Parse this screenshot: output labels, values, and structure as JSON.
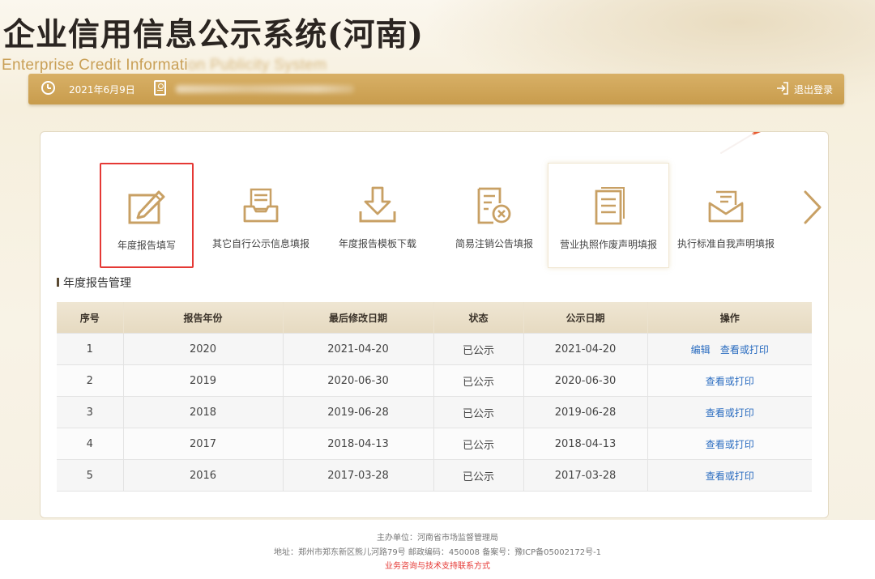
{
  "header": {
    "title": "企业信用信息公示系统(河南)",
    "subtitle_visible": "Enterprise Credit Informati",
    "subtitle_blurred": "on Publicity System",
    "date": "2021年6月9日",
    "logout_label": "退出登录"
  },
  "menu": {
    "items": [
      {
        "label": "年度报告填写",
        "icon": "edit-report-icon"
      },
      {
        "label": "其它自行公示信息填报",
        "icon": "inbox-tray-icon"
      },
      {
        "label": "年度报告模板下载",
        "icon": "download-icon"
      },
      {
        "label": "简易注销公告填报",
        "icon": "document-cancel-icon"
      },
      {
        "label": "营业执照作废声明填报",
        "icon": "document-icon"
      },
      {
        "label": "执行标准自我声明填报",
        "icon": "envelope-icon"
      }
    ],
    "selected_index": 0
  },
  "section": {
    "title": "年度报告管理"
  },
  "table": {
    "headers": [
      "序号",
      "报告年份",
      "最后修改日期",
      "状态",
      "公示日期",
      "操作"
    ],
    "rows": [
      {
        "no": "1",
        "year": "2020",
        "modified": "2021-04-20",
        "status": "已公示",
        "publish": "2021-04-20",
        "actions": [
          "编辑",
          "查看或打印"
        ]
      },
      {
        "no": "2",
        "year": "2019",
        "modified": "2020-06-30",
        "status": "已公示",
        "publish": "2020-06-30",
        "actions": [
          "查看或打印"
        ]
      },
      {
        "no": "3",
        "year": "2018",
        "modified": "2019-06-28",
        "status": "已公示",
        "publish": "2019-06-28",
        "actions": [
          "查看或打印"
        ]
      },
      {
        "no": "4",
        "year": "2017",
        "modified": "2018-04-13",
        "status": "已公示",
        "publish": "2018-04-13",
        "actions": [
          "查看或打印"
        ]
      },
      {
        "no": "5",
        "year": "2016",
        "modified": "2017-03-28",
        "status": "已公示",
        "publish": "2017-03-28",
        "actions": [
          "查看或打印"
        ]
      }
    ]
  },
  "footer": {
    "line1": "主办单位：河南省市场监督管理局",
    "line2": "地址：郑州市郑东新区熊儿河路79号 邮政编码：450008 备案号：豫ICP备05002172号-1",
    "line3": "业务咨询与技术支持联系方式"
  },
  "colors": {
    "accent_gold": "#c89c4d",
    "link_blue": "#2a6cc0",
    "selected_red": "#e53935"
  }
}
